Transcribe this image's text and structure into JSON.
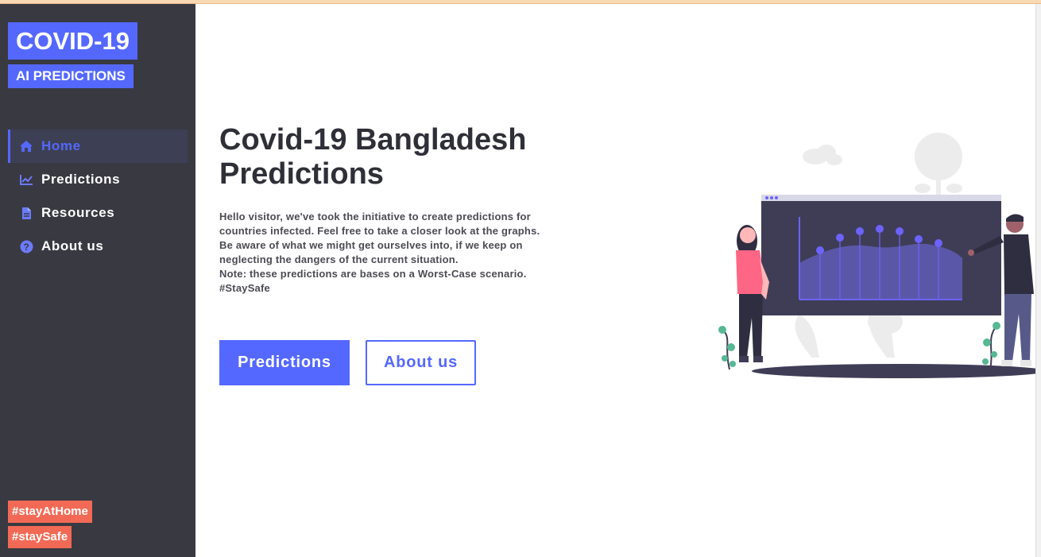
{
  "sidebar": {
    "logo_title": "COVID-19",
    "logo_subtitle": "AI PREDICTIONS",
    "nav": [
      {
        "label": "Home",
        "icon": "home-icon",
        "active": true
      },
      {
        "label": "Predictions",
        "icon": "chart-line-icon",
        "active": false
      },
      {
        "label": "Resources",
        "icon": "file-icon",
        "active": false
      },
      {
        "label": "About us",
        "icon": "question-circle-icon",
        "active": false
      }
    ],
    "tags": [
      "#stayAtHome",
      "#staySafe"
    ]
  },
  "hero": {
    "title": "Covid-19 Bangladesh Predictions",
    "paragraphs": [
      "Hello visitor, we've took the initiative to create predictions for countries infected. Feel free to take a closer look at the graphs.",
      "Be aware of what we might get ourselves into, if we keep on neglecting the dangers of the current situation.",
      "Note: these predictions are bases on a Worst-Case scenario.",
      "#StaySafe"
    ],
    "primary_button": "Predictions",
    "secondary_button": "About us"
  },
  "colors": {
    "accent": "#5468ff",
    "sidebar_bg": "#393942",
    "tag_bg": "#f26a55",
    "title_text": "#2f2f38"
  }
}
